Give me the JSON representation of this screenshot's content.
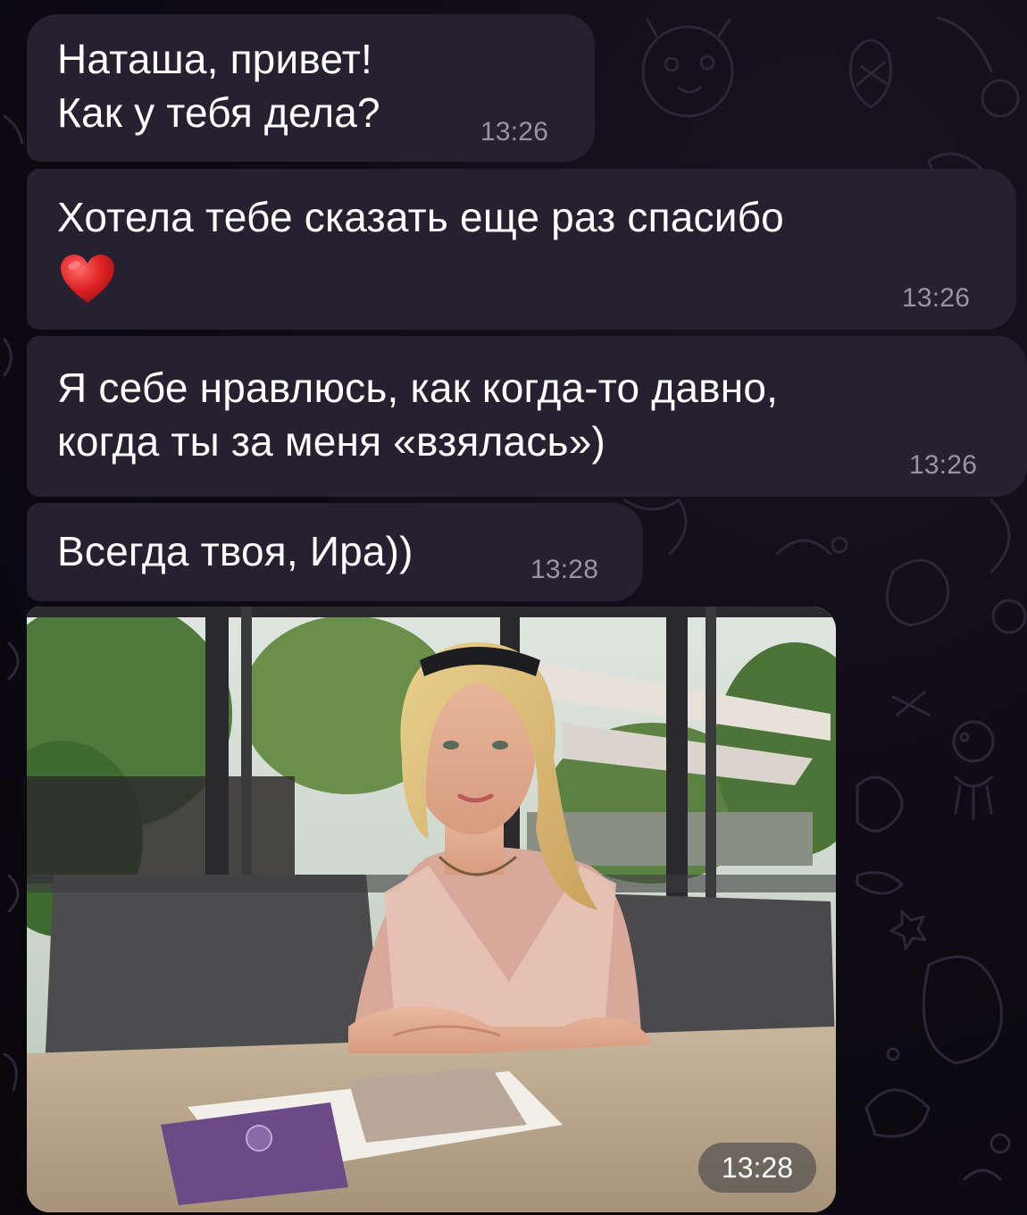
{
  "messages": [
    {
      "lines": [
        "Наташа, привет!",
        "Как у тебя дела?"
      ],
      "time": "13:26"
    },
    {
      "lines": [
        "Хотела тебе сказать еще раз спасибо"
      ],
      "emoji": "heart-emoji",
      "time": "13:26"
    },
    {
      "lines": [
        "Я себе нравлюсь, как когда-то давно,",
        "когда ты за меня «взялась»)"
      ],
      "time": "13:26"
    },
    {
      "lines": [
        "Всегда твоя, Ира))"
      ],
      "time": "13:28"
    }
  ],
  "photo": {
    "time": "13:28"
  },
  "colors": {
    "bubble": "#262030",
    "background": "#0b0810",
    "text": "#ffffff",
    "timestamp": "#9a93a6",
    "heart": "#e02424"
  }
}
